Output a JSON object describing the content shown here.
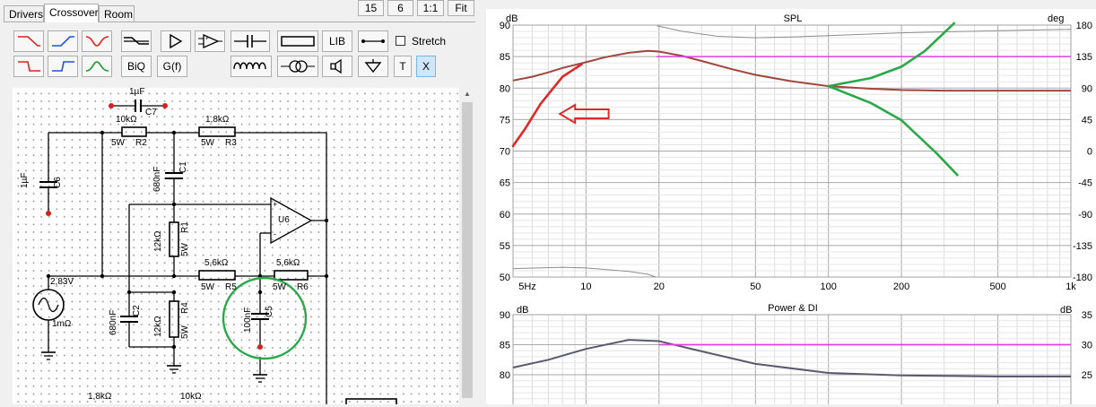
{
  "tabs": [
    "Drivers",
    "Crossover",
    "Room"
  ],
  "zoom_buttons": [
    "15",
    "6",
    "1:1",
    "Fit"
  ],
  "toolbar": {
    "row1_text_buttons": {
      "lib": "LIB"
    },
    "row2_text_buttons": {
      "biq": "BiQ",
      "gf": "G(f)",
      "t": "T",
      "x": "X"
    },
    "stretch_label": "Stretch"
  },
  "schematic": {
    "c7": {
      "value": "1µF",
      "ref": "C7"
    },
    "r2": {
      "value": "10kΩ",
      "power": "5W",
      "ref": "R2"
    },
    "r3": {
      "value": "1,8kΩ",
      "power": "5W",
      "ref": "R3"
    },
    "c6": {
      "value": "1µF",
      "ref": "C6"
    },
    "c1": {
      "value": "680nF",
      "ref": "C1"
    },
    "r1": {
      "value": "12kΩ",
      "power": "5W",
      "ref": "R1"
    },
    "u6": {
      "ref": "U6",
      "plus": "+",
      "minus": "-"
    },
    "r5": {
      "value": "5,6kΩ",
      "power": "5W",
      "ref": "R5"
    },
    "r6": {
      "value": "5,6kΩ",
      "power": "5W",
      "ref": "R6"
    },
    "source": {
      "voltage": "2,83V",
      "impedance": "1mΩ"
    },
    "c2": {
      "value": "680nF",
      "ref": "C2"
    },
    "r4": {
      "value": "12kΩ",
      "power": "5W",
      "ref": "R4"
    },
    "c5": {
      "value": "100nF",
      "ref": "C5"
    },
    "bottom": {
      "left": "1,8kΩ",
      "right": "10kΩ"
    }
  },
  "colors": {
    "spl_trace": "#a0463c",
    "target_trace": "#e040e0",
    "phase_trace": "#8c8c8c",
    "annotation_red": "#e02828",
    "annotation_green": "#2aa84a",
    "power_trace": "#5a5a6e"
  },
  "chart_data": [
    {
      "type": "line",
      "title": "SPL",
      "ylabel": "dB",
      "y2label": "deg",
      "xscale": "log",
      "xlim": [
        5,
        1000
      ],
      "ylim": [
        50,
        90
      ],
      "y2lim": [
        -180,
        180
      ],
      "x_tick_labels": [
        "5Hz",
        "10",
        "20",
        "50",
        "100",
        "200",
        "500",
        "1k"
      ],
      "y_ticks": [
        90,
        85,
        80,
        75,
        70,
        65,
        60,
        55,
        50
      ],
      "y2_ticks": [
        180,
        135,
        90,
        45,
        0,
        -45,
        -90,
        -135,
        -180
      ],
      "grid": true,
      "series": [
        {
          "x": [
            5,
            6,
            7,
            8,
            10,
            12,
            15,
            18,
            20,
            25,
            30,
            40,
            50,
            70,
            100,
            150,
            200,
            300,
            500,
            700,
            1000
          ],
          "y": [
            81.2,
            81.8,
            82.5,
            83.2,
            84.1,
            84.9,
            85.6,
            85.9,
            85.8,
            85.1,
            84.3,
            83.0,
            82.1,
            81.1,
            80.3,
            79.9,
            79.7,
            79.6,
            79.6,
            79.6,
            79.6
          ]
        },
        {
          "x": [
            19.5,
            1000
          ],
          "y": [
            85,
            85
          ]
        },
        {
          "axis": "y2",
          "x": [
            5,
            8,
            10,
            15,
            18,
            19.4
          ],
          "y": [
            -168,
            -166,
            -167,
            -172,
            -176,
            -180
          ]
        },
        {
          "axis": "y2",
          "x": [
            19.6,
            25,
            35,
            50,
            70,
            100,
            200,
            500,
            1000
          ],
          "y": [
            179,
            171,
            164,
            162,
            163,
            165,
            169,
            172,
            174
          ]
        }
      ],
      "annotations": {
        "red_curve": {
          "x": [
            5,
            5.6,
            6.5,
            8,
            9.6
          ],
          "y": [
            70.8,
            73.5,
            77.5,
            81.8,
            83.8
          ]
        },
        "red_arrow": {
          "x": [
            7.8,
            12.4
          ],
          "y": [
            75.9,
            75.9
          ]
        },
        "green_upper": {
          "x": [
            100,
            150,
            200,
            250,
            330
          ],
          "y": [
            80.3,
            81.6,
            83.4,
            85.9,
            90.3
          ]
        },
        "green_lower": {
          "x": [
            100,
            150,
            200,
            280,
            340
          ],
          "y": [
            80.3,
            77.6,
            74.9,
            69.6,
            66.2
          ]
        }
      }
    },
    {
      "type": "line",
      "title": "Power & DI",
      "ylabel": "dB",
      "y2label": "dB",
      "xscale": "log",
      "xlim": [
        5,
        1000
      ],
      "ylim": [
        75,
        90
      ],
      "y2lim": [
        20,
        35
      ],
      "y_ticks": [
        90,
        85,
        80
      ],
      "y2_ticks": [
        35,
        30,
        25
      ],
      "grid": true,
      "series": [
        {
          "x": [
            5,
            7,
            10,
            15,
            20,
            30,
            50,
            100,
            200,
            500,
            1000
          ],
          "y": [
            81.2,
            82.5,
            84.3,
            85.8,
            85.6,
            83.9,
            81.8,
            80.3,
            79.9,
            79.7,
            79.7
          ]
        },
        {
          "x": [
            20,
            1000
          ],
          "y": [
            85,
            85
          ]
        }
      ]
    }
  ]
}
